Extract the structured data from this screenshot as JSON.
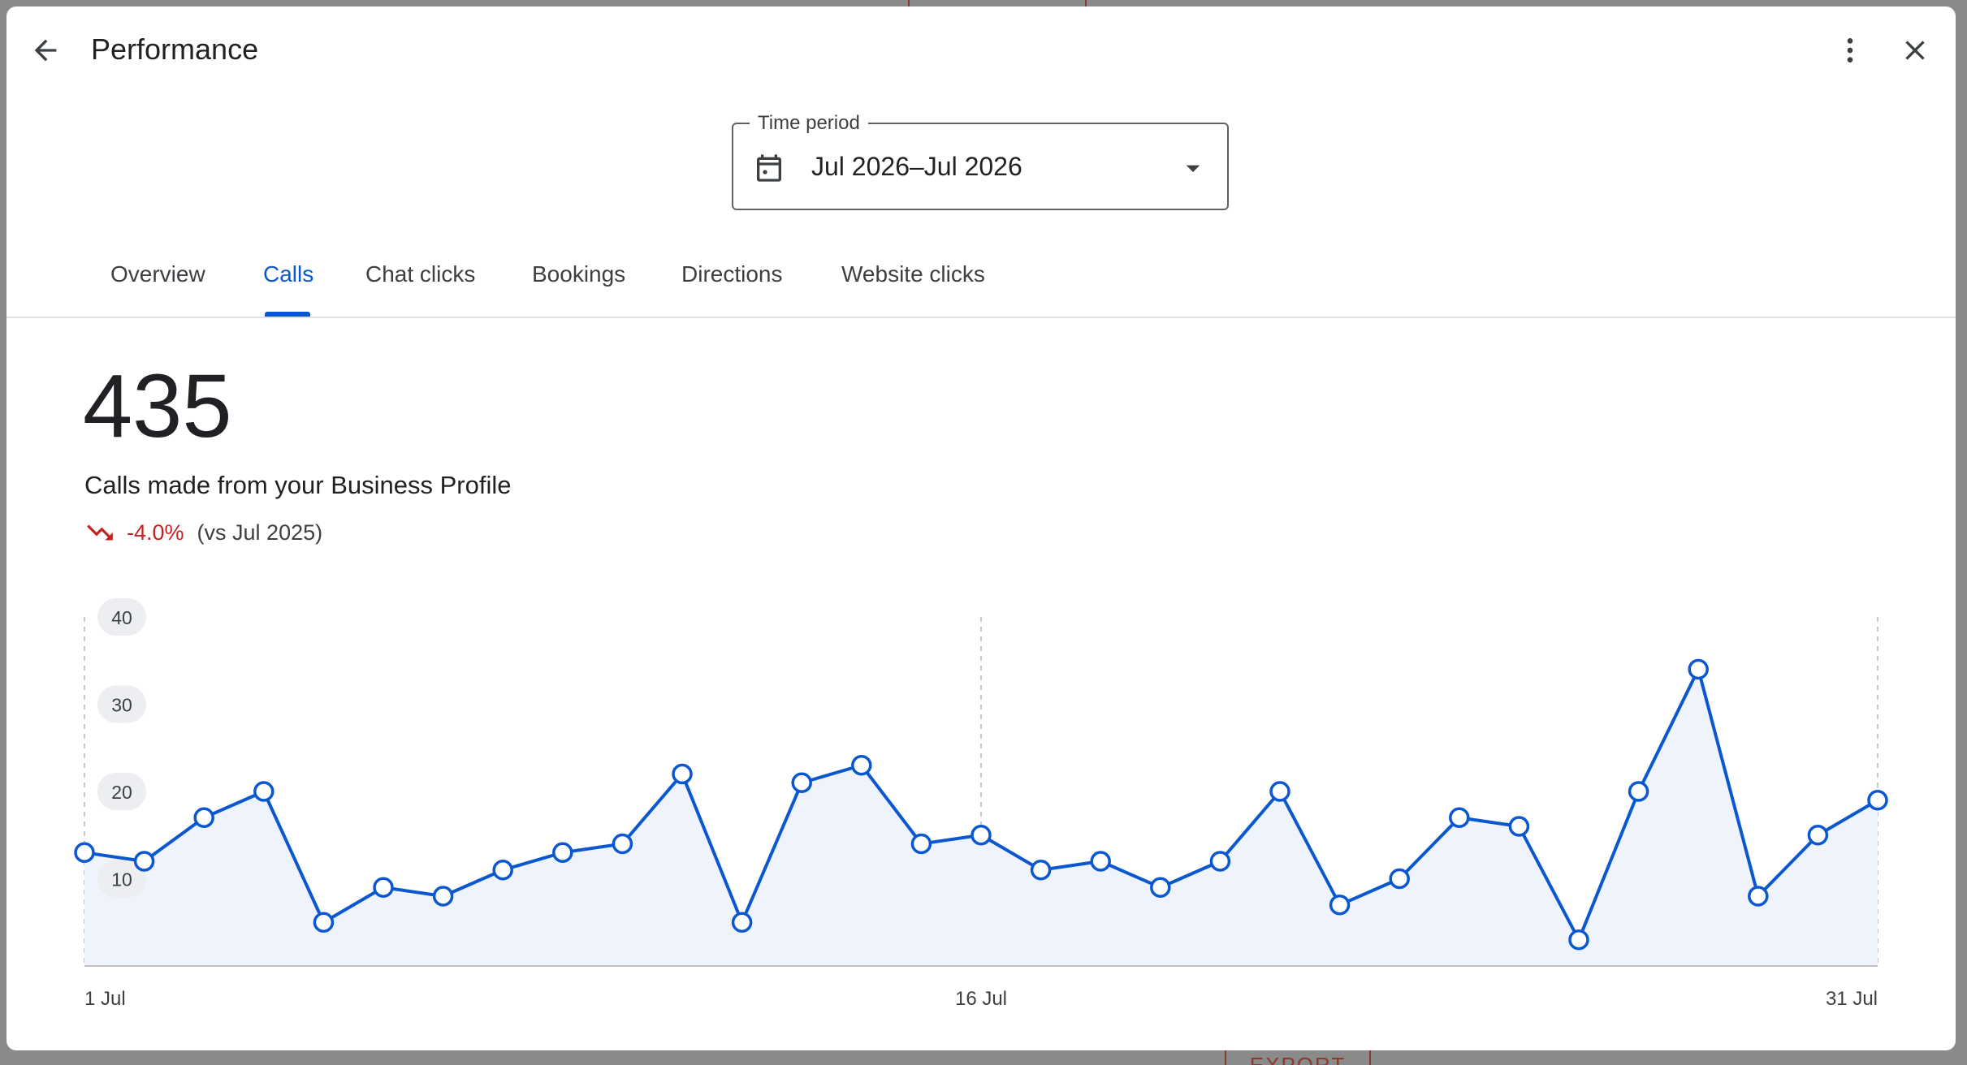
{
  "header": {
    "title": "Performance",
    "back_icon": "arrow-left-icon",
    "more_icon": "more-vert-icon",
    "close_icon": "close-icon"
  },
  "time_period": {
    "label": "Time period",
    "value": "Jul 2026–Jul 2026",
    "icon": "calendar-icon",
    "dropdown_icon": "arrow-drop-down-icon"
  },
  "tabs": [
    {
      "label": "Overview"
    },
    {
      "label": "Calls",
      "active": true
    },
    {
      "label": "Chat clicks"
    },
    {
      "label": "Bookings"
    },
    {
      "label": "Directions"
    },
    {
      "label": "Website clicks"
    }
  ],
  "summary": {
    "total": "435",
    "label": "Calls made from your Business Profile",
    "change": "-4.0%",
    "comparison": "(vs Jul 2025)",
    "trend_icon": "trending-down-icon",
    "trend_color": "#c5221f"
  },
  "colors": {
    "accent": "#0b57d0",
    "area_fill": "#eef3fc",
    "negative": "#c5221f"
  },
  "chart_data": {
    "type": "area",
    "x": [
      "1 Jul",
      "2 Jul",
      "3 Jul",
      "4 Jul",
      "5 Jul",
      "6 Jul",
      "7 Jul",
      "8 Jul",
      "9 Jul",
      "10 Jul",
      "11 Jul",
      "12 Jul",
      "13 Jul",
      "14 Jul",
      "15 Jul",
      "16 Jul",
      "17 Jul",
      "18 Jul",
      "19 Jul",
      "20 Jul",
      "21 Jul",
      "22 Jul",
      "23 Jul",
      "24 Jul",
      "25 Jul",
      "26 Jul",
      "27 Jul",
      "28 Jul",
      "29 Jul",
      "30 Jul",
      "31 Jul"
    ],
    "values": [
      13,
      12,
      17,
      20,
      5,
      9,
      8,
      11,
      13,
      14,
      22,
      5,
      21,
      23,
      14,
      15,
      11,
      12,
      9,
      12,
      20,
      7,
      10,
      17,
      16,
      3,
      20,
      34,
      8,
      15,
      19
    ],
    "x_tick_labels": [
      "1 Jul",
      "16 Jul",
      "31 Jul"
    ],
    "y_tick_labels": [
      "10",
      "20",
      "30",
      "40"
    ],
    "ylim": [
      0,
      40
    ],
    "grid": "vertical dashed at 1 Jul, 16 Jul, 31 Jul",
    "title": "",
    "xlabel": "",
    "ylabel": ""
  }
}
